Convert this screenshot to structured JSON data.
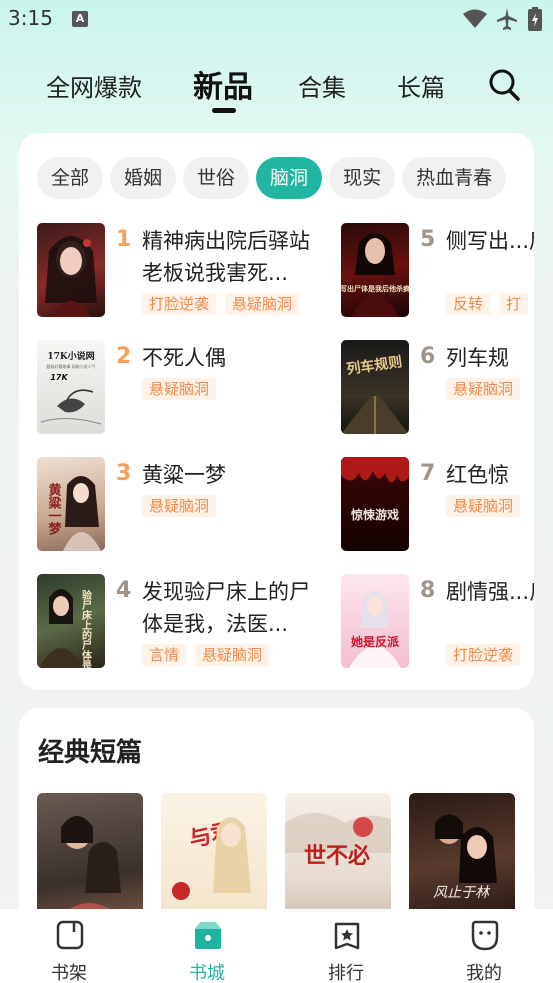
{
  "status_bar": {
    "time": "3:15"
  },
  "tabs": [
    {
      "label": "全网爆款"
    },
    {
      "label": "新品"
    },
    {
      "label": "合集"
    },
    {
      "label": "长篇"
    }
  ],
  "active_tab": "新品",
  "filters": {
    "chips": [
      "全部",
      "婚姻",
      "世俗",
      "脑洞",
      "现实",
      "热血青春"
    ],
    "selected": "脑洞"
  },
  "ranking": {
    "items": [
      {
        "rank": "1",
        "title": "精神病出院后驿站老板说我害死...",
        "tags": [
          "打脸逆袭",
          "悬疑脑洞"
        ]
      },
      {
        "rank": "2",
        "title": "不死人偶",
        "tags": [
          "悬疑脑洞"
        ]
      },
      {
        "rank": "3",
        "title": "黄粱一梦",
        "tags": [
          "悬疑脑洞"
        ]
      },
      {
        "rank": "4",
        "title": "发现验尸床上的尸体是我，法医...",
        "tags": [
          "言情",
          "悬疑脑洞"
        ]
      },
      {
        "rank": "5",
        "title": "侧写出...后，他...",
        "tags": [
          "反转",
          "打"
        ]
      },
      {
        "rank": "6",
        "title": "列车规",
        "tags": [
          "悬疑脑洞"
        ]
      },
      {
        "rank": "7",
        "title": "红色惊",
        "tags": [
          "悬疑脑洞"
        ]
      },
      {
        "rank": "8",
        "title": "剧情强...反派后",
        "tags": [
          "打脸逆袭"
        ]
      }
    ]
  },
  "covers": {
    "c2_brand": "17K小说网",
    "c2_line": "超级好看故事 网络小说人气",
    "c5_text": "侧写出尸体是我后他杀疯了",
    "c6_text": "列车规则",
    "c7_text": "惊悚游戏",
    "c8_text": "她是反派",
    "c3_text": "黄粱一梦",
    "c4_text": "验尸床上的尸体是我",
    "s2_text": "与君",
    "s3_text": "世不必",
    "s4_text": "风止于林"
  },
  "classic_shorts": {
    "title": "经典短篇"
  },
  "bottom_nav": [
    {
      "label": "书架",
      "icon": "bookshelf-icon"
    },
    {
      "label": "书城",
      "icon": "bookstore-icon"
    },
    {
      "label": "排行",
      "icon": "ranking-icon"
    },
    {
      "label": "我的",
      "icon": "profile-icon"
    }
  ],
  "colors": {
    "accent": "#21b6a2",
    "tag_text": "#f08b4b",
    "tag_bg": "#fff3e9",
    "rank_top": "#f7a05b"
  }
}
